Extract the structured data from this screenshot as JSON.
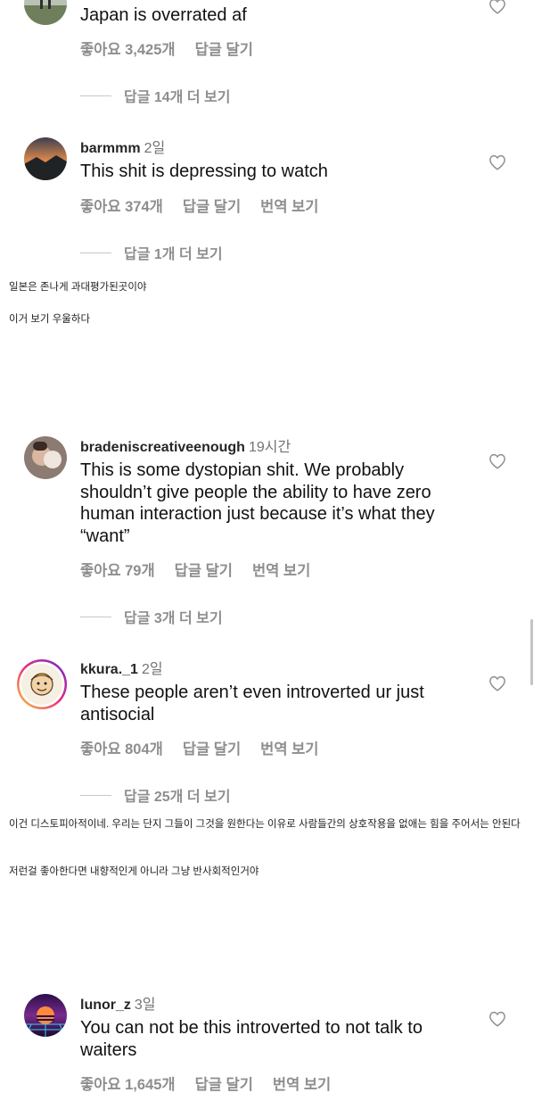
{
  "comments": [
    {
      "username": "",
      "time": "",
      "text": "Japan is overrated af",
      "likes": "좋아요 3,425개",
      "reply_action": "답글 달기",
      "translate_action": "",
      "view_replies": "답글 14개 더 보기"
    },
    {
      "username": "barmmm",
      "time": "2일",
      "text": "This shit is depressing to watch",
      "likes": "좋아요 374개",
      "reply_action": "답글 달기",
      "translate_action": "번역 보기",
      "view_replies": "답글 1개 더 보기"
    },
    {
      "username": "bradeniscreativeenough",
      "time": "19시간",
      "text": "This is some dystopian shit. We probably shouldn’t give people the ability to have zero human interaction just because it’s what they “want”",
      "likes": "좋아요 79개",
      "reply_action": "답글 달기",
      "translate_action": "번역 보기",
      "view_replies": "답글 3개 더 보기"
    },
    {
      "username": "kkura._1",
      "time": "2일",
      "text": "These people aren’t even introverted ur just antisocial",
      "likes": "좋아요 804개",
      "reply_action": "답글 달기",
      "translate_action": "번역 보기",
      "view_replies": "답글 25개 더 보기"
    },
    {
      "username": "lunor_z",
      "time": "3일",
      "text": "You can not be this introverted to not talk to waiters",
      "likes": "좋아요 1,645개",
      "reply_action": "답글 달기",
      "translate_action": "번역 보기",
      "view_replies": ""
    }
  ],
  "translations": {
    "block1": [
      "일본은 존나게 과대평가된곳이야",
      "이거 보기 우울하다"
    ],
    "block2": [
      "이건 디스토피아적이네. 우리는 단지 그들이 그것을 원한다는 이유로 사람들간의 상호작용을 없애는 힘을 주어서는 안된다",
      "저런걸 좋아한다면 내향적인게 아니라 그냥 반사회적인거야"
    ]
  },
  "icons": {
    "like": "heart-outline-icon",
    "avatar": "avatar"
  },
  "colors": {
    "secondary_text": "#8e8e8e",
    "divider": "#c7c7c7",
    "story_ring": [
      "#f9ce34",
      "#ee2a7b",
      "#6228d7"
    ]
  }
}
